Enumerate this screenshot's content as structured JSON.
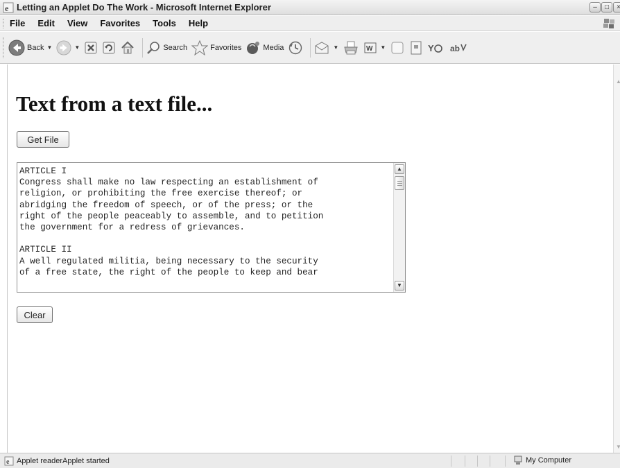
{
  "window": {
    "title": "Letting an Applet Do The Work - Microsoft Internet Explorer"
  },
  "menu": [
    "File",
    "Edit",
    "View",
    "Favorites",
    "Tools",
    "Help"
  ],
  "toolbar": {
    "back_label": "Back",
    "search_label": "Search",
    "favorites_label": "Favorites",
    "media_label": "Media"
  },
  "page": {
    "heading": "Text from a text file...",
    "get_file_label": "Get File",
    "clear_label": "Clear",
    "textarea_lines": [
      "ARTICLE I",
      "Congress shall make no law respecting an establishment of",
      "religion, or prohibiting the free exercise thereof; or",
      "abridging the freedom of speech, or of the press; or the",
      "right of the people peaceably to assemble, and to petition",
      "the government for a redress of grievances.",
      "",
      "ARTICLE II",
      "A well regulated militia, being necessary to the security",
      "of a free state, the right of the people to keep and bear"
    ]
  },
  "status": {
    "text": "Applet readerApplet started",
    "zone": "My Computer"
  },
  "icons": {
    "back": "back-arrow-icon",
    "forward": "forward-arrow-icon",
    "stop": "stop-icon",
    "refresh": "refresh-icon",
    "home": "home-icon",
    "search": "search-icon",
    "favorites": "favorites-star-icon",
    "media": "media-icon",
    "history": "history-icon",
    "mail": "mail-icon",
    "print": "print-icon",
    "edit": "word-edit-icon",
    "discuss": "discuss-icon",
    "messenger": "messenger-icon",
    "research": "research-icon"
  }
}
